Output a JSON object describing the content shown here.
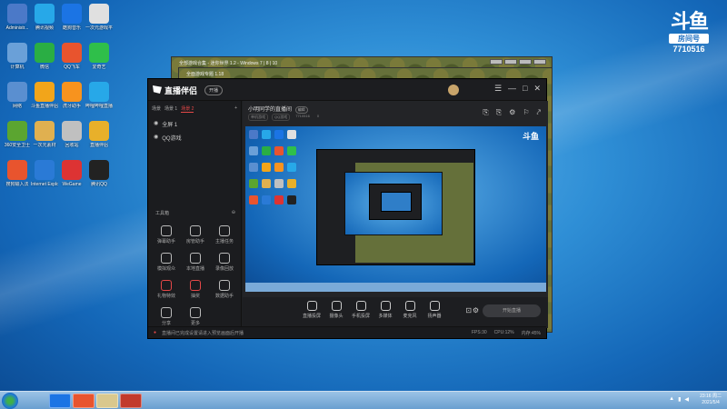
{
  "desktop_icons": [
    {
      "label": "Administr...",
      "color": "#4b79c8"
    },
    {
      "label": "腾讯视频",
      "color": "#27a8e8"
    },
    {
      "label": "酷狗音乐",
      "color": "#1b74e4"
    },
    {
      "label": "一次元游戏平台",
      "color": "#e0e0e0"
    },
    {
      "label": "计算机",
      "color": "#6aa0d8"
    },
    {
      "label": "微信",
      "color": "#2aae44"
    },
    {
      "label": "QQ飞车",
      "color": "#e8542e"
    },
    {
      "label": "爱奇艺",
      "color": "#2fbf4a"
    },
    {
      "label": "网络",
      "color": "#5a8fd0"
    },
    {
      "label": "斗鱼直播伴侣",
      "color": "#f2a51a"
    },
    {
      "label": "虎牙助手",
      "color": "#f7931e"
    },
    {
      "label": "哔哩哔哩直播姬",
      "color": "#27a8e8"
    },
    {
      "label": "360安全卫士",
      "color": "#5ba530"
    },
    {
      "label": "一次元素材",
      "color": "#e0b050"
    },
    {
      "label": "回收站",
      "color": "#c0c0c0"
    },
    {
      "label": "直播伴侣",
      "color": "#e8b02a"
    },
    {
      "label": "搜狗输入法",
      "color": "#e8542e"
    },
    {
      "label": "Internet Explorer",
      "color": "#2a7ad6"
    },
    {
      "label": "WeGame",
      "color": "#d33"
    },
    {
      "label": "腾讯QQ",
      "color": "#222"
    }
  ],
  "watermark": {
    "site": "斗鱼",
    "label": "房间号",
    "room": "7710516"
  },
  "back_windows": [
    {
      "title": "全部游戏合集 - 迷你世界 1.2 - Windows 7 | 8 | 10"
    },
    {
      "title": "全面游戏专题 1.18"
    }
  ],
  "app": {
    "name": "直播伴侣",
    "pill": "开播",
    "window_controls": [
      "☰",
      "—",
      "□",
      "✕"
    ],
    "scene_tabs": [
      {
        "label": "场景",
        "active": false
      },
      {
        "label": "场景 1",
        "active": false
      },
      {
        "label": "场景 2",
        "active": true
      }
    ],
    "sources": [
      {
        "label": "全屏 1"
      },
      {
        "label": "QQ游戏"
      }
    ],
    "tools_header": "工具箱",
    "tools": [
      {
        "label": "弹幕助手",
        "red": false
      },
      {
        "label": "房管助手",
        "red": false
      },
      {
        "label": "主播任务",
        "red": false
      },
      {
        "label": "模拟观众",
        "red": false
      },
      {
        "label": "本地直播",
        "red": false
      },
      {
        "label": "录像回放",
        "red": false
      },
      {
        "label": "礼物特效",
        "red": true
      },
      {
        "label": "抽奖",
        "red": true
      },
      {
        "label": "数据助手",
        "red": false
      },
      {
        "label": "分享",
        "red": false
      },
      {
        "label": "更多",
        "red": false
      }
    ],
    "room": {
      "title": "小明同学的直播间",
      "tag": "编辑",
      "sub": [
        "单机游戏",
        "QQ游戏",
        "7710516"
      ],
      "viewers": "0",
      "header_icons": [
        "⎘",
        "⎘",
        "⚙",
        "⚐",
        "⤤"
      ]
    },
    "bottom_buttons": [
      {
        "label": "直播投屏"
      },
      {
        "label": "摄像头"
      },
      {
        "label": "手机投屏"
      },
      {
        "label": "多媒体"
      },
      {
        "label": "麦克风"
      },
      {
        "label": "扬声器"
      }
    ],
    "go_live": "开始直播",
    "status": {
      "warning": "直播间已完成设置请进入预览画面后开播",
      "fps": "FPS:30",
      "cpu": "CPU:12%",
      "mem": "内存:45%"
    }
  },
  "taskbar": {
    "clock_time": "23:16",
    "clock_day": "周二",
    "clock_date": "2021/5/4"
  }
}
